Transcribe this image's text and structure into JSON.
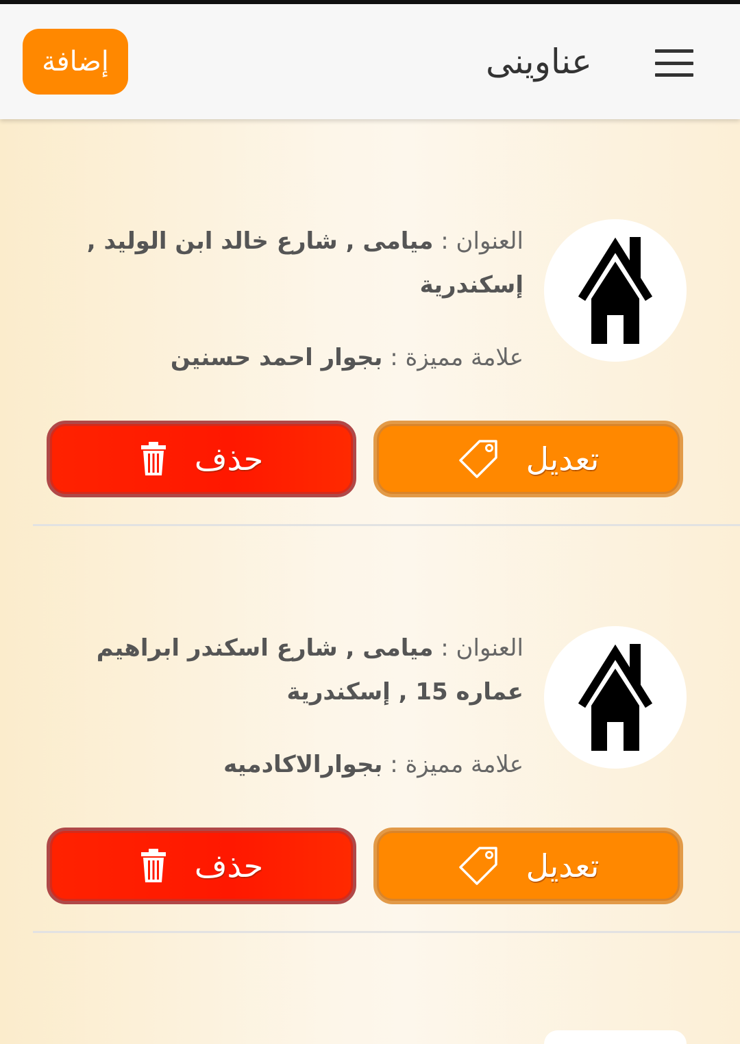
{
  "header": {
    "title": "عناوينى",
    "add_label": "إضافة"
  },
  "addresses": [
    {
      "address_label": "العنوان :",
      "address_value_line1": "ميامى , شارع خالد ابن الوليد ,",
      "address_value_line2": "إسكندرية",
      "landmark_label": "علامة مميزة :",
      "landmark_value": "بجوار احمد حسنين",
      "edit_label": "تعديل",
      "delete_label": "حذف"
    },
    {
      "address_label": "العنوان :",
      "address_value_line1": "ميامى , شارع اسكندر ابراهيم",
      "address_value_line2": "عماره 15 , إسكندرية",
      "landmark_label": "علامة مميزة :",
      "landmark_value": "بجوارالاكادميه",
      "edit_label": "تعديل",
      "delete_label": "حذف"
    }
  ],
  "colors": {
    "accent": "#ff8800",
    "danger": "#ff1a00",
    "header_bg": "#f7f7f7",
    "page_bg": "#fdf5e6"
  },
  "icons": {
    "menu": "menu-icon",
    "avatar": "house-icon",
    "edit": "tag-icon",
    "delete": "trash-icon"
  }
}
